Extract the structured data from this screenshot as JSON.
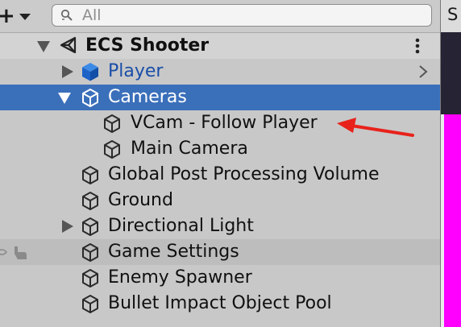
{
  "toolbar": {
    "create_icon": "plus-icon",
    "dropdown_icon": "triangle-down-icon",
    "search": {
      "placeholder": "All",
      "icon": "search-icon"
    }
  },
  "scene_tab": {
    "label": "S"
  },
  "hierarchy": {
    "scene": {
      "name": "ECS Shooter",
      "icon": "unity-logo-icon",
      "menu_icon": "kebab-menu-icon"
    },
    "items": [
      {
        "label": "Player",
        "icon": "prefab-cube-icon",
        "state": "prefab",
        "foldout": "collapsed"
      },
      {
        "label": "Cameras",
        "icon": "gameobject-cube-icon",
        "state": "selected",
        "foldout": "expanded"
      },
      {
        "label": "VCam - Follow Player",
        "icon": "gameobject-cube-icon",
        "state": "normal"
      },
      {
        "label": "Main Camera",
        "icon": "gameobject-cube-icon",
        "state": "normal"
      },
      {
        "label": "Global Post Processing Volume",
        "icon": "gameobject-cube-icon",
        "state": "normal"
      },
      {
        "label": "Ground",
        "icon": "gameobject-cube-icon",
        "state": "normal"
      },
      {
        "label": "Directional Light",
        "icon": "gameobject-cube-icon",
        "state": "normal",
        "foldout": "collapsed"
      },
      {
        "label": "Game Settings",
        "icon": "gameobject-cube-icon",
        "state": "hover"
      },
      {
        "label": "Enemy Spawner",
        "icon": "gameobject-cube-icon",
        "state": "normal"
      },
      {
        "label": "Bullet Impact Object Pool",
        "icon": "gameobject-cube-icon",
        "state": "normal"
      }
    ]
  },
  "annotation": {
    "icon": "red-arrow-icon",
    "color": "#e8221b"
  },
  "colors": {
    "selection": "#3a6fba",
    "prefab_text": "#1a4ea8",
    "scene_view_magenta": "#ff00ff"
  }
}
